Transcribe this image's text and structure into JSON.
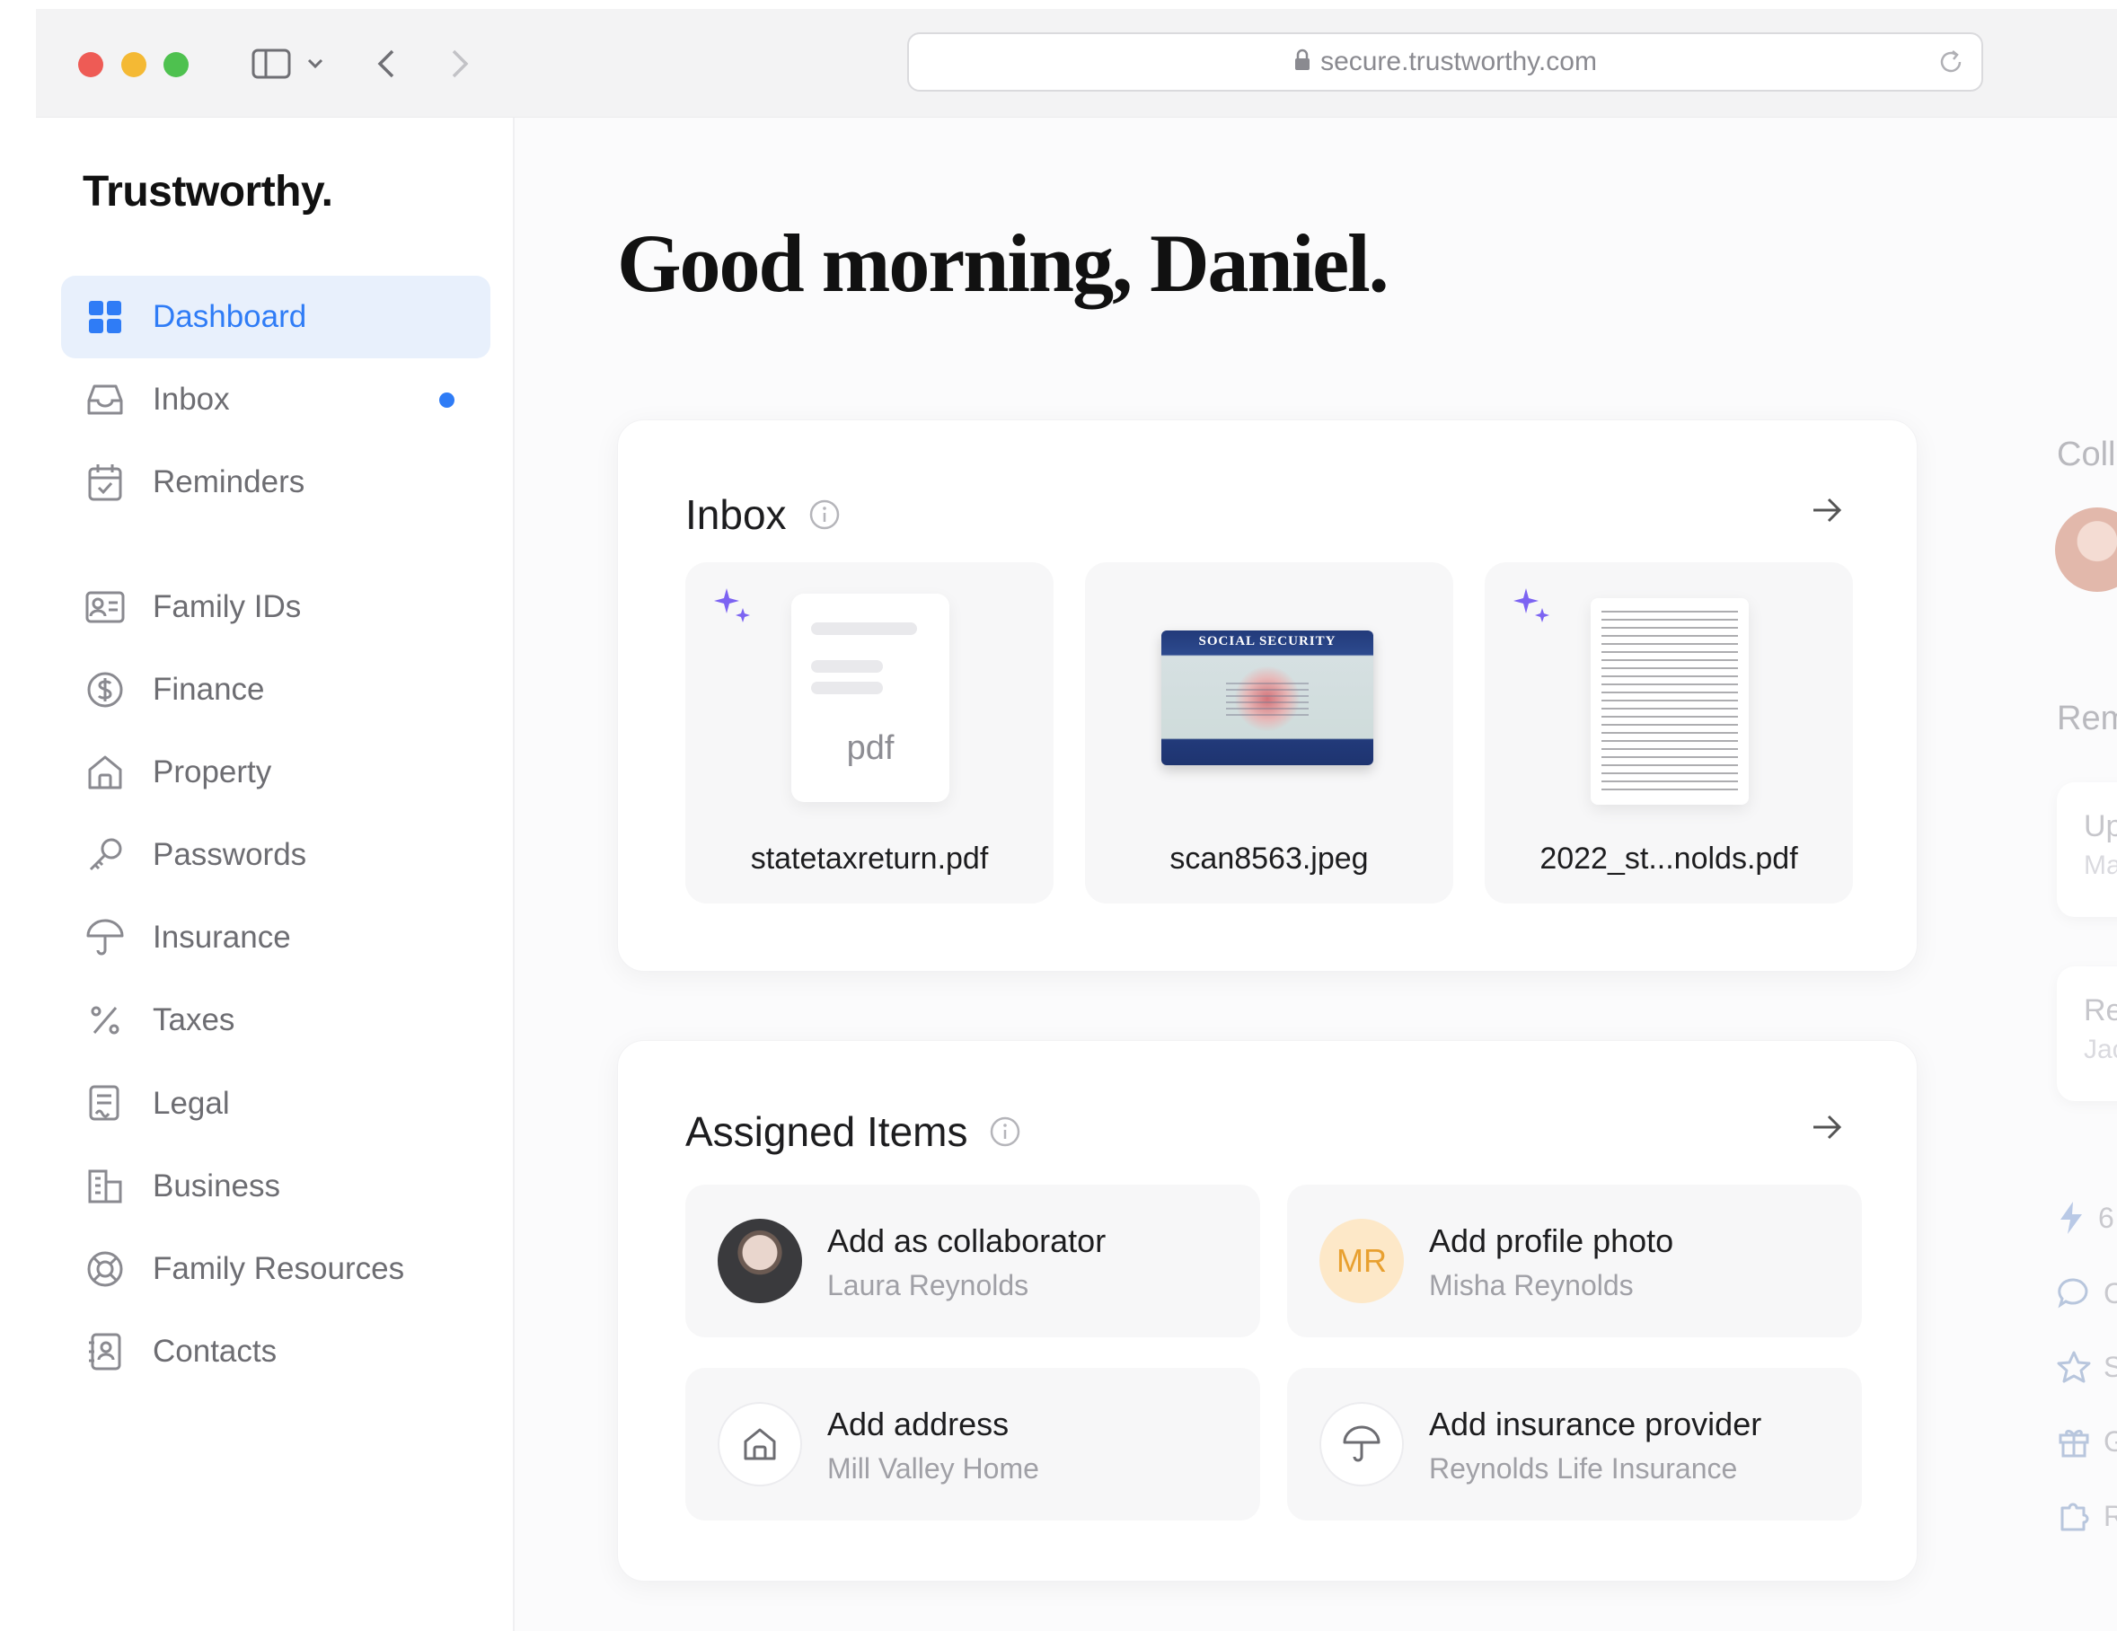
{
  "browser": {
    "url": "secure.trustworthy.com"
  },
  "sidebar": {
    "brand": "Trustworthy.",
    "items": [
      {
        "label": "Dashboard",
        "icon": "grid-icon",
        "active": true
      },
      {
        "label": "Inbox",
        "icon": "inbox-icon",
        "unread": true
      },
      {
        "label": "Reminders",
        "icon": "calendar-icon"
      },
      {
        "label": "Family IDs",
        "icon": "id-card-icon"
      },
      {
        "label": "Finance",
        "icon": "dollar-circle-icon"
      },
      {
        "label": "Property",
        "icon": "house-icon"
      },
      {
        "label": "Passwords",
        "icon": "key-icon"
      },
      {
        "label": "Insurance",
        "icon": "umbrella-icon"
      },
      {
        "label": "Taxes",
        "icon": "percent-icon"
      },
      {
        "label": "Legal",
        "icon": "document-signature-icon"
      },
      {
        "label": "Business",
        "icon": "building-icon"
      },
      {
        "label": "Family Resources",
        "icon": "lifebuoy-icon"
      },
      {
        "label": "Contacts",
        "icon": "contact-book-icon"
      }
    ]
  },
  "main": {
    "greeting": "Good morning, Daniel.",
    "inbox": {
      "title": "Inbox",
      "files": [
        {
          "name": "statetaxreturn.pdf",
          "thumb_text": "pdf",
          "ai_sparkle": true
        },
        {
          "name": "scan8563.jpeg",
          "thumb_text": "SOCIAL SECURITY",
          "ai_sparkle": false
        },
        {
          "name": "2022_st...nolds.pdf",
          "ai_sparkle": true
        }
      ]
    },
    "assigned": {
      "title": "Assigned Items",
      "items": [
        {
          "title": "Add as collaborator",
          "subtitle": "Laura Reynolds",
          "avatar": "photo"
        },
        {
          "title": "Add profile photo",
          "subtitle": "Misha Reynolds",
          "avatar": "initials",
          "initials": "MR"
        },
        {
          "title": "Add address",
          "subtitle": "Mill Valley Home",
          "avatar": "house-icon"
        },
        {
          "title": "Add insurance provider",
          "subtitle": "Reynolds Life Insurance",
          "avatar": "umbrella-icon"
        }
      ]
    }
  },
  "right_panel": {
    "collab_heading": "Colla",
    "remind_heading": "Remi",
    "card1_title": "Up",
    "card1_sub": "Ma",
    "card2_title": "Rei",
    "card2_sub": "Jac",
    "stat": "6",
    "links": [
      "C",
      "S",
      "G",
      "R"
    ]
  },
  "colors": {
    "accent": "#2f7cf6",
    "sparkle": "#7c63f2",
    "initials_bg": "#fde8c8",
    "initials_fg": "#e8a030"
  }
}
